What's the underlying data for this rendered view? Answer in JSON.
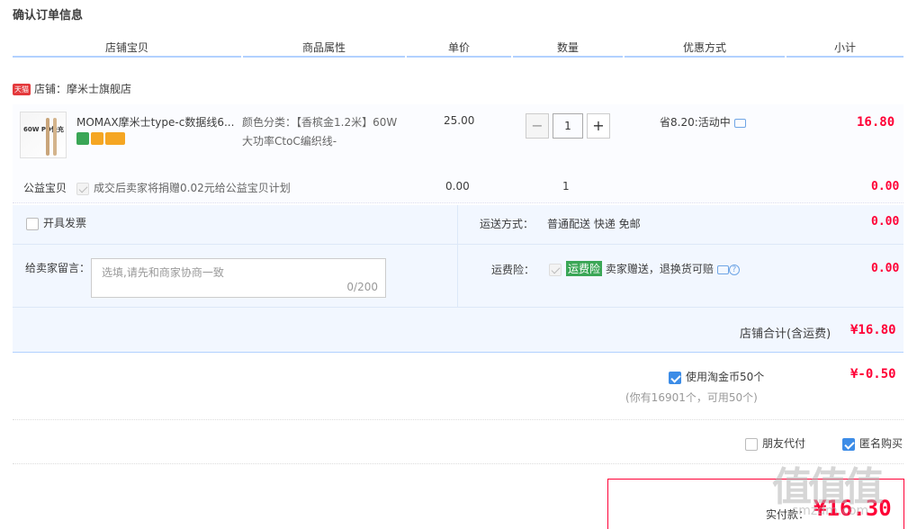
{
  "page": {
    "title": "确认订单信息"
  },
  "header": {
    "columns": [
      "店铺宝贝",
      "商品属性",
      "单价",
      "数量",
      "优惠方式",
      "小计"
    ]
  },
  "shop": {
    "tag": "天猫",
    "label": "店铺：摩米士旗舰店"
  },
  "item": {
    "thumb_text": "60W PD快充",
    "name": "MOMAX摩米士type-c数据线6...",
    "attr_line1": "颜色分类：【香槟金1.2米】60W",
    "attr_line2": "大功率CtoC编织线-",
    "price": "25.00",
    "qty": "1",
    "qty_minus": "−",
    "qty_plus": "+",
    "discount": "省8.20:活动中",
    "subtotal": "16.80",
    "badge_colors": [
      "#3aa656",
      "#f5a623",
      "#f5a623"
    ]
  },
  "charity": {
    "label": "公益宝贝",
    "text": "成交后卖家将捐赠0.02元给公益宝贝计划",
    "price": "0.00",
    "qty": "1",
    "subtotal": "0.00"
  },
  "invoice": {
    "label": "开具发票"
  },
  "shipping": {
    "label": "运送方式：",
    "value": "普通配送 快递 免邮",
    "amount": "0.00"
  },
  "message": {
    "label": "给卖家留言：",
    "placeholder": "选填,请先和商家协商一致",
    "count": "0/200"
  },
  "insurance": {
    "label": "运费险：",
    "tag": "运费险",
    "text": "卖家赠送，退换货可赔",
    "amount": "0.00"
  },
  "shop_total": {
    "label": "店铺合计(含运费)",
    "amount": "¥16.80"
  },
  "coins": {
    "label": "使用淘金币50个",
    "amount": "¥-0.50",
    "note": "(你有16901个，可用50个)"
  },
  "options": {
    "friend_pay": "朋友代付",
    "anonymous": "匿名购买"
  },
  "payment": {
    "label": "实付款：",
    "amount": "¥16.30"
  },
  "watermark": {
    "glyph": "值值值",
    "site": "smzdm.com"
  },
  "colors": {
    "accent": "#ff0036",
    "border_blue": "#b2d1ff",
    "panel_bg": "#f2f7ff",
    "check_blue": "#3c8ce7"
  }
}
